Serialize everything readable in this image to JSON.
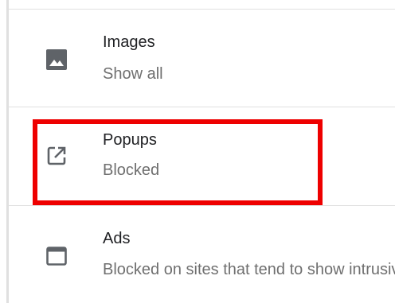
{
  "clipped_top_text": "",
  "settings": {
    "items": [
      {
        "title": "Images",
        "subtitle": "Show all",
        "icon": "image-icon"
      },
      {
        "title": "Popups",
        "subtitle": "Blocked",
        "icon": "open-in-new-icon"
      },
      {
        "title": "Ads",
        "subtitle": "Blocked on sites that tend to show intrusive or misleading ads",
        "icon": "web-asset-icon"
      }
    ]
  },
  "colors": {
    "title": "#202124",
    "subtitle": "#6f6f6f",
    "icon": "#5f6368",
    "divider": "#e0e0e0",
    "highlight": "#ee0000"
  }
}
